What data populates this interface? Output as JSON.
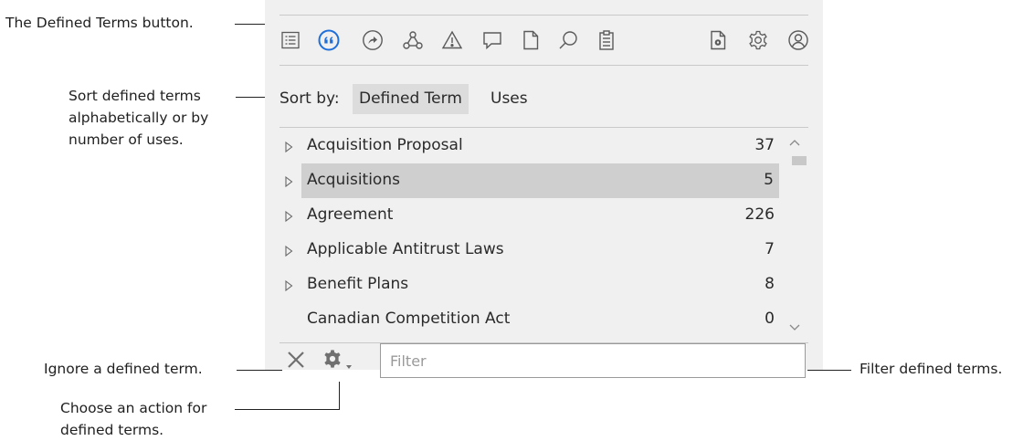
{
  "callouts": {
    "defined_terms_button": "The Defined Terms button.",
    "sort_line1": "Sort defined terms",
    "sort_line2": "alphabetically or by",
    "sort_line3": "number of uses.",
    "ignore": "Ignore a defined term.",
    "action_line1": "Choose an action for",
    "action_line2": "defined terms.",
    "filter": "Filter defined terms."
  },
  "toolbar": {
    "icons": [
      "outline-icon",
      "defined-terms-icon",
      "cross-references-icon",
      "parties-icon",
      "warning-icon",
      "comment-icon",
      "document-icon",
      "search-icon",
      "clipboard-icon",
      "document-settings-icon",
      "settings-icon",
      "account-icon"
    ],
    "active_color": "#1e6fd9"
  },
  "sort": {
    "label": "Sort by:",
    "options": [
      "Defined Term",
      "Uses"
    ],
    "active": "Defined Term"
  },
  "terms": [
    {
      "term": "Acquisition Proposal",
      "uses": "37",
      "expandable": true,
      "selected": false
    },
    {
      "term": "Acquisitions",
      "uses": "5",
      "expandable": true,
      "selected": true
    },
    {
      "term": "Agreement",
      "uses": "226",
      "expandable": true,
      "selected": false
    },
    {
      "term": "Applicable Antitrust Laws",
      "uses": "7",
      "expandable": true,
      "selected": false
    },
    {
      "term": "Benefit Plans",
      "uses": "8",
      "expandable": true,
      "selected": false
    },
    {
      "term": "Canadian Competition Act",
      "uses": "0",
      "expandable": false,
      "selected": false
    }
  ],
  "filter": {
    "placeholder": "Filter",
    "value": ""
  }
}
